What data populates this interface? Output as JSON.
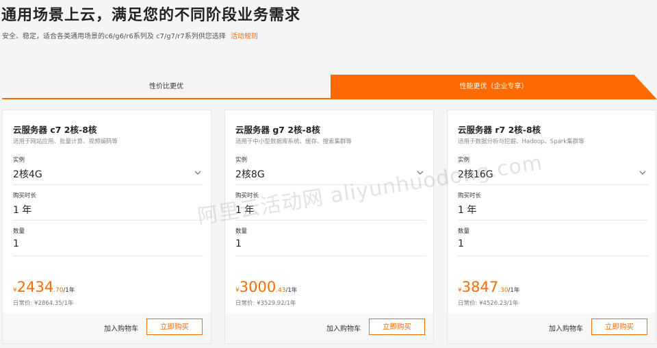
{
  "header": {
    "title": "通用场景上云，满足您的不同阶段业务需求",
    "subtitle": "安全、稳定，适合各类通用场景的c6/g6/r6系列及 c7/g7/r7系列供您选择",
    "rules_link": "活动规则"
  },
  "tabs": [
    {
      "label": "性价比更优",
      "active": false
    },
    {
      "label": "性能更优（企业专享）",
      "active": true
    }
  ],
  "colors": {
    "accent": "#ff6a00"
  },
  "cards": [
    {
      "name": "云服务器 c7 2核-8核",
      "desc": "适用于网站应用、批量计算、视频编码等",
      "instance_label": "实例",
      "instance_value": "2核4G",
      "duration_label": "购买时长",
      "duration_value": "1 年",
      "qty_label": "数量",
      "qty_value": "1",
      "currency": "¥",
      "price_int": "2434",
      "price_dec": ".70",
      "price_unit": "/1年",
      "original": "日常价: ¥2864.35/1年",
      "cart": "加入购物车",
      "buy": "立即购买"
    },
    {
      "name": "云服务器 g7 2核-8核",
      "desc": "适用于中小型数据库系统、缓存、搜索集群等",
      "instance_label": "实例",
      "instance_value": "2核8G",
      "duration_label": "购买时长",
      "duration_value": "1 年",
      "qty_label": "数量",
      "qty_value": "1",
      "currency": "¥",
      "price_int": "3000",
      "price_dec": ".43",
      "price_unit": "/1年",
      "original": "日常价: ¥3529.92/1年",
      "cart": "加入购物车",
      "buy": "立即购买"
    },
    {
      "name": "云服务器 r7 2核-8核",
      "desc": "适用于数据分析与挖掘、Hadoop、Spark集群等",
      "instance_label": "实例",
      "instance_value": "2核16G",
      "duration_label": "购买时长",
      "duration_value": "1 年",
      "qty_label": "数量",
      "qty_value": "1",
      "currency": "¥",
      "price_int": "3847",
      "price_dec": ".30",
      "price_unit": "/1年",
      "original": "日常价: ¥4526.23/1年",
      "cart": "加入购物车",
      "buy": "立即购买"
    }
  ],
  "watermark": "阿里云活动网 aliyunhuodong.com"
}
